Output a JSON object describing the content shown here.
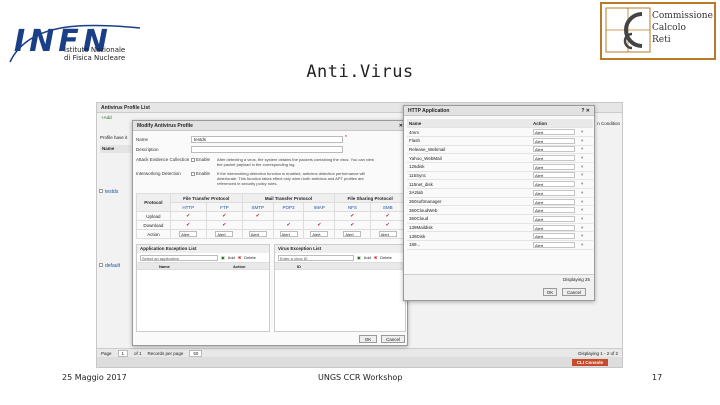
{
  "slide": {
    "title": "Anti.Virus",
    "footer_left": "25 Maggio 2017",
    "footer_center": "UNGS CCR Workshop",
    "footer_right": "17",
    "infn_logo_text": "INFN",
    "infn_subtitle_1": "Istituto Nazionale",
    "infn_subtitle_2": "di Fisica Nucleare",
    "ccr_lines": [
      "Commissione",
      "Calcolo",
      "Reti"
    ]
  },
  "app": {
    "list_title": "Antivirus Profile List",
    "toolbar_add": "+Add",
    "profile_have": "Profile have it",
    "col_name": "Name",
    "rows": [
      "testds",
      "default"
    ],
    "condition": "n Condition",
    "pager": {
      "page_label": "Page",
      "page": "1",
      "of": "of 1",
      "records_label": "Records per page",
      "records": "50",
      "display": "Displaying 1 - 2 of 2"
    },
    "cli": "CLI Console"
  },
  "modify": {
    "title": "Modify Antivirus Profile",
    "name_label": "Name",
    "name_value": "testds",
    "description_label": "Description",
    "attack_label": "Attack Evidence Collection",
    "enable": "Enable",
    "attack_desc": "After detecting a virus, the system obtains the packets containing the virus. You can view the packet payload in the corresponding log.",
    "interwork_label": "Interworking Detection",
    "interwork_desc": "If the interworking detection function is enabled, antivirus detection performance will deteriorate. This function takes effect only when both antivirus and APT profiles are referenced in security policy rules.",
    "protocol_label": "Protocol",
    "groups": [
      "File Transfer Protocol",
      "Mail Transfer Protocol",
      "File Sharing Protocol"
    ],
    "protocols": [
      "HTTP",
      "FTP",
      "SMTP",
      "POP3",
      "IMAP",
      "NFS",
      "SMB"
    ],
    "upload": "Upload",
    "download": "Download",
    "action": "Action",
    "action_value": "Alert",
    "app_exc_title": "Application Exception List",
    "app_exc_placeholder": "Select an application",
    "add": "Add",
    "delete": "Delete",
    "col_name": "Name",
    "col_action": "Action",
    "virus_exc_title": "Virus Exception List",
    "virus_exc_placeholder": "Enter a virus ID",
    "col_id": "ID",
    "ok": "OK",
    "cancel": "Cancel"
  },
  "http_app": {
    "title": "HTTP Application",
    "col_name": "Name",
    "col_action": "Action",
    "items": [
      "4mm",
      "Flash",
      "Release_Webmail",
      "Yahoo_WebMail",
      "126disk",
      "115Sync",
      "115net_disk",
      "3A2lab",
      "360softmanager",
      "360CloudWeb",
      "360Cloud",
      "139Maildisk",
      "139Disk",
      "189..."
    ],
    "action_value": "Alert",
    "display": "Displaying 25",
    "ok": "OK",
    "cancel": "Cancel"
  }
}
